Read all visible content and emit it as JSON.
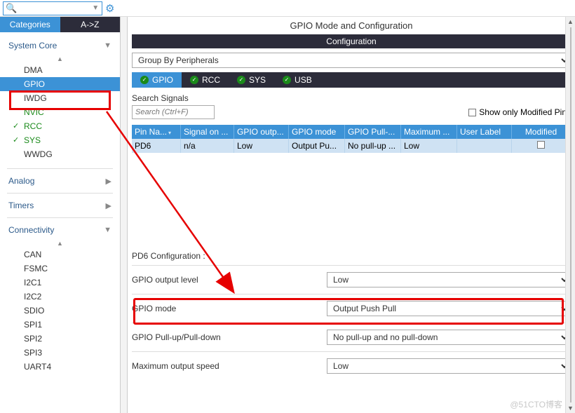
{
  "topbar": {
    "search_value": "",
    "search_placeholder": ""
  },
  "sidebar": {
    "tabs": {
      "categories": "Categories",
      "az": "A->Z"
    },
    "sections": [
      {
        "name": "System Core",
        "expanded": true,
        "items": [
          {
            "label": "DMA"
          },
          {
            "label": "GPIO",
            "selected": true
          },
          {
            "label": "IWDG"
          },
          {
            "label": "NVIC",
            "green": true
          },
          {
            "label": "RCC",
            "green": true,
            "check": true
          },
          {
            "label": "SYS",
            "green": true,
            "check": true
          },
          {
            "label": "WWDG"
          }
        ]
      },
      {
        "name": "Analog",
        "expanded": false
      },
      {
        "name": "Timers",
        "expanded": false
      },
      {
        "name": "Connectivity",
        "expanded": true,
        "items": [
          {
            "label": "CAN"
          },
          {
            "label": "FSMC"
          },
          {
            "label": "I2C1"
          },
          {
            "label": "I2C2"
          },
          {
            "label": "SDIO"
          },
          {
            "label": "SPI1"
          },
          {
            "label": "SPI2"
          },
          {
            "label": "SPI3"
          },
          {
            "label": "UART4"
          }
        ]
      }
    ]
  },
  "content": {
    "title": "GPIO Mode and Configuration",
    "conf_header": "Configuration",
    "groupby": "Group By Peripherals",
    "peripheral_tabs": [
      {
        "label": "GPIO",
        "active": true
      },
      {
        "label": "RCC"
      },
      {
        "label": "SYS"
      },
      {
        "label": "USB"
      }
    ],
    "search_label": "Search Signals",
    "search_placeholder": "Search (Ctrl+F)",
    "show_modified": "Show only Modified Pins",
    "grid": {
      "headers": [
        "Pin Na...",
        "Signal on ...",
        "GPIO outp...",
        "GPIO mode",
        "GPIO Pull-...",
        "Maximum ...",
        "User Label",
        "Modified"
      ],
      "row": {
        "pin": "PD6",
        "signal": "n/a",
        "out": "Low",
        "mode": "Output Pu...",
        "pull": "No pull-up ...",
        "max": "Low",
        "user": "",
        "modified": false
      }
    },
    "pd6_header": "PD6 Configuration :",
    "fields": [
      {
        "label": "GPIO output level",
        "value": "Low"
      },
      {
        "label": "GPIO mode",
        "value": "Output Push Pull"
      },
      {
        "label": "GPIO Pull-up/Pull-down",
        "value": "No pull-up and no pull-down"
      },
      {
        "label": "Maximum output speed",
        "value": "Low"
      }
    ]
  },
  "watermark": "@51CTO博客"
}
